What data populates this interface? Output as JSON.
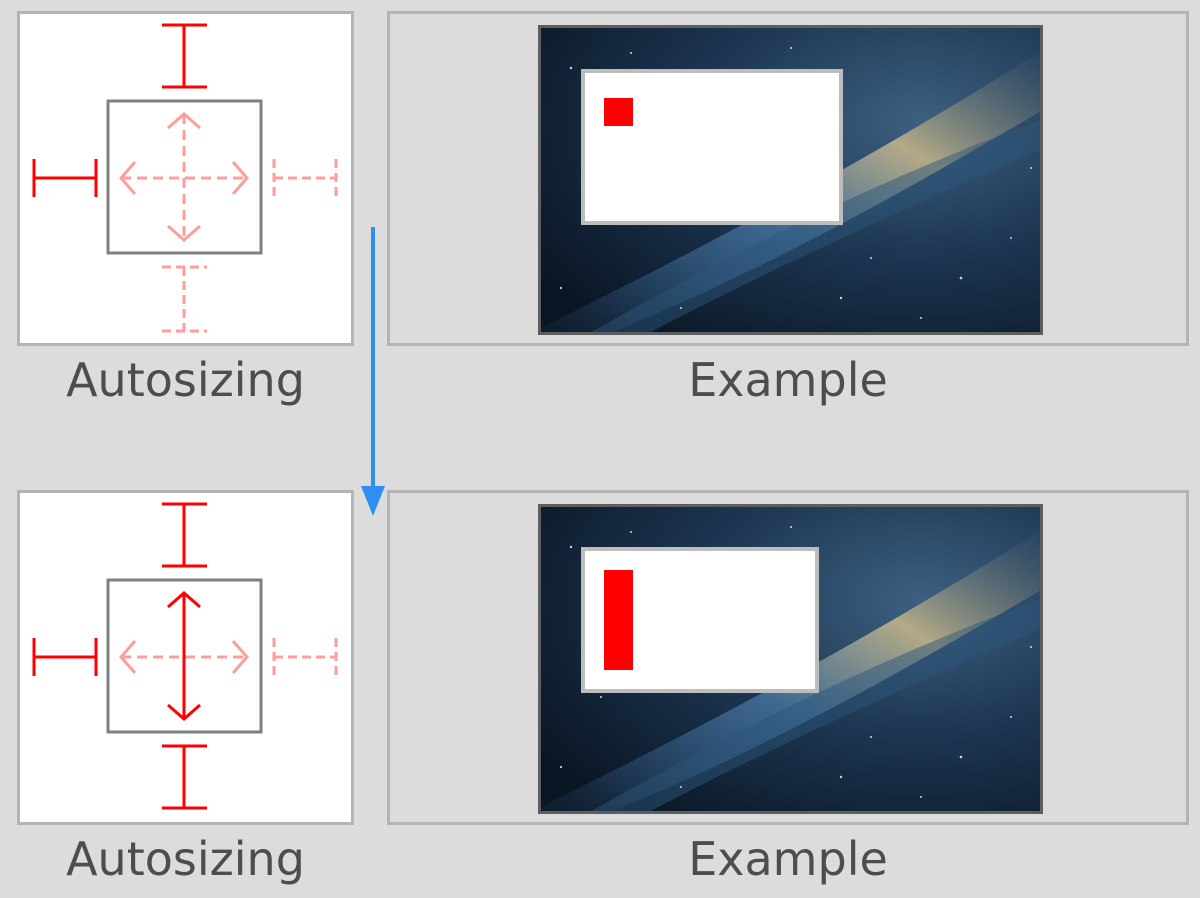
{
  "top": {
    "autosizing_caption": "Autosizing",
    "example_caption": "Example",
    "struts": {
      "top": true,
      "left": true,
      "right": false,
      "bottom": false
    },
    "springs": {
      "horizontal": false,
      "vertical": false
    }
  },
  "bottom": {
    "autosizing_caption": "Autosizing",
    "example_caption": "Example",
    "struts": {
      "top": true,
      "left": true,
      "right": false,
      "bottom": true
    },
    "springs": {
      "horizontal": false,
      "vertical": true
    }
  },
  "icons": {
    "flow_arrow": "down-arrow-icon",
    "strut_icon": "strut-icon",
    "spring_icon": "spring-icon"
  },
  "colors": {
    "active": "#ff0000",
    "inactive": "#ff9c9c",
    "flow_arrow": "#2f8ff0",
    "subview": "#ff0000",
    "frame": "#808080"
  }
}
